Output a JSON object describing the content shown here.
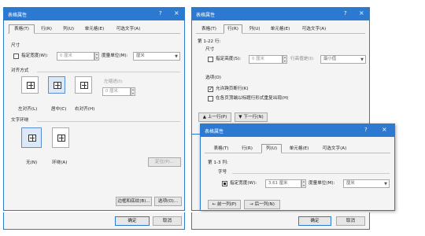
{
  "dialog1": {
    "title": "表格属性",
    "help": "?",
    "close": "×",
    "tabs": [
      "表格(T)",
      "行(R)",
      "列(U)",
      "单元格(E)",
      "可选文字(A)"
    ],
    "size_heading": "尺寸",
    "preferred_width_label": "指定宽度(W):",
    "preferred_width_value": "0 厘米",
    "measure_in_label": "度量单位(M):",
    "measure_in_value": "厘米",
    "alignment_heading": "对齐方式",
    "indent_label": "左缩进(I):",
    "indent_value": "0 厘米",
    "align_left": "左对齐(L)",
    "align_center": "居中(C)",
    "align_right": "右对齐(H)",
    "wrapping_heading": "文字环绕",
    "wrap_none": "无(N)",
    "wrap_around": "环绕(A)",
    "positioning": "定位(P)...",
    "borders_shading": "边框和底纹(B)...",
    "options": "选项(O)...",
    "ok": "确定",
    "cancel": "取消"
  },
  "dialog2": {
    "title": "表格属性",
    "help": "?",
    "close": "×",
    "tabs": [
      "表格(T)",
      "行(R)",
      "列(U)",
      "单元格(E)",
      "可选文字(A)"
    ],
    "rows_label": "第 1-22 行:",
    "size_heading": "尺寸",
    "specify_height_label": "指定高度(S):",
    "specify_height_value": "0 厘米",
    "row_height_is_label": "行高值是(I):",
    "row_height_is_value": "最小值",
    "options_heading": "选项(O)",
    "allow_break": "允许跨页断行(K)",
    "repeat_header": "在各页顶端以标题行形式重复出现(H)",
    "prev_row": "上一行(P)",
    "next_row": "下一行(N)"
  },
  "dialog3": {
    "title": "表格属性",
    "help": "?",
    "close": "×",
    "tabs": [
      "表格(T)",
      "行(R)",
      "列(U)",
      "单元格(E)",
      "可选文字(A)"
    ],
    "columns_label": "第 1-3 列:",
    "size_heading": "字号",
    "preferred_width_label": "指定宽度(W):",
    "preferred_width_value": "3.61 厘米",
    "measure_in_label": "度量单位(M):",
    "measure_in_value": "厘米",
    "prev_column": "前一列(P)",
    "next_column": "后一列(N)",
    "ok": "确定",
    "cancel": "取消"
  }
}
